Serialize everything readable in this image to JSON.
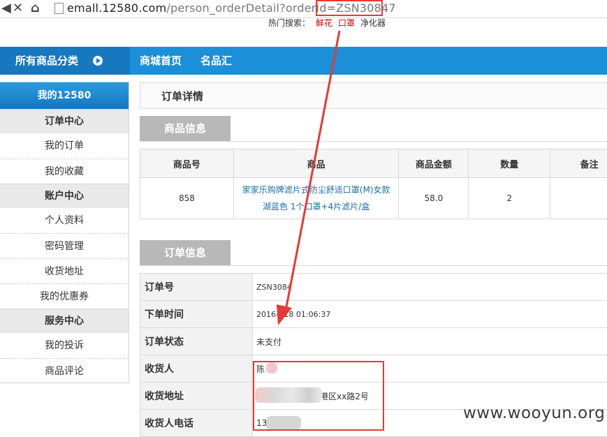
{
  "browser": {
    "url_host": "emall.12580.com",
    "url_path": "/person_orderDetail?orderid=",
    "url_order_id": "ZSN30847"
  },
  "header": {
    "hot_search_label": "热门搜索：",
    "hot_search_keywords": [
      "鲜花",
      "口罩",
      "净化器"
    ]
  },
  "top_nav": {
    "all_categories": "所有商品分类",
    "links": [
      "商城首页",
      "名品汇"
    ]
  },
  "sidebar": {
    "title": "我的12580",
    "sections": [
      {
        "title": "订单中心",
        "items": [
          "我的订单",
          "我的收藏"
        ]
      },
      {
        "title": "账户中心",
        "items": [
          "个人资料",
          "密码管理",
          "收货地址",
          "我的优惠券"
        ]
      },
      {
        "title": "服务中心",
        "items": [
          "我的投诉",
          "商品评论"
        ]
      }
    ]
  },
  "main": {
    "page_title": "订单详情",
    "goods_section_title": "商品信息",
    "goods_table": {
      "headers": [
        "商品号",
        "商品",
        "商品金额",
        "数量",
        "备注"
      ],
      "rows": [
        {
          "id": "858",
          "product_line1": "家家乐购牌滤片式防尘舒适口罩(M)女款",
          "product_line2": "湖蓝色 1个口罩+4片滤片/盒",
          "amount": "58.0",
          "qty": "2",
          "note": ""
        }
      ]
    },
    "order_section_title": "订单信息",
    "order_fields": [
      {
        "label": "订单号",
        "value": "ZSN3084"
      },
      {
        "label": "下单时间",
        "value": "2016-  -18 01:06:37"
      },
      {
        "label": "订单状态",
        "value": "未支付"
      },
      {
        "label": "收货人",
        "value": "陈"
      },
      {
        "label": "收货地址",
        "value": "港区xx路2号"
      },
      {
        "label": "收货人电话",
        "value": "13"
      }
    ]
  },
  "watermark": "www.wooyun.org",
  "colors": {
    "nav_blue": "#1b8fd8",
    "annotation_red": "#e53935",
    "tab_gray": "#b8b8b8"
  },
  "icons": [
    "close-icon",
    "home-icon",
    "page-icon",
    "arrow-right-icon"
  ]
}
